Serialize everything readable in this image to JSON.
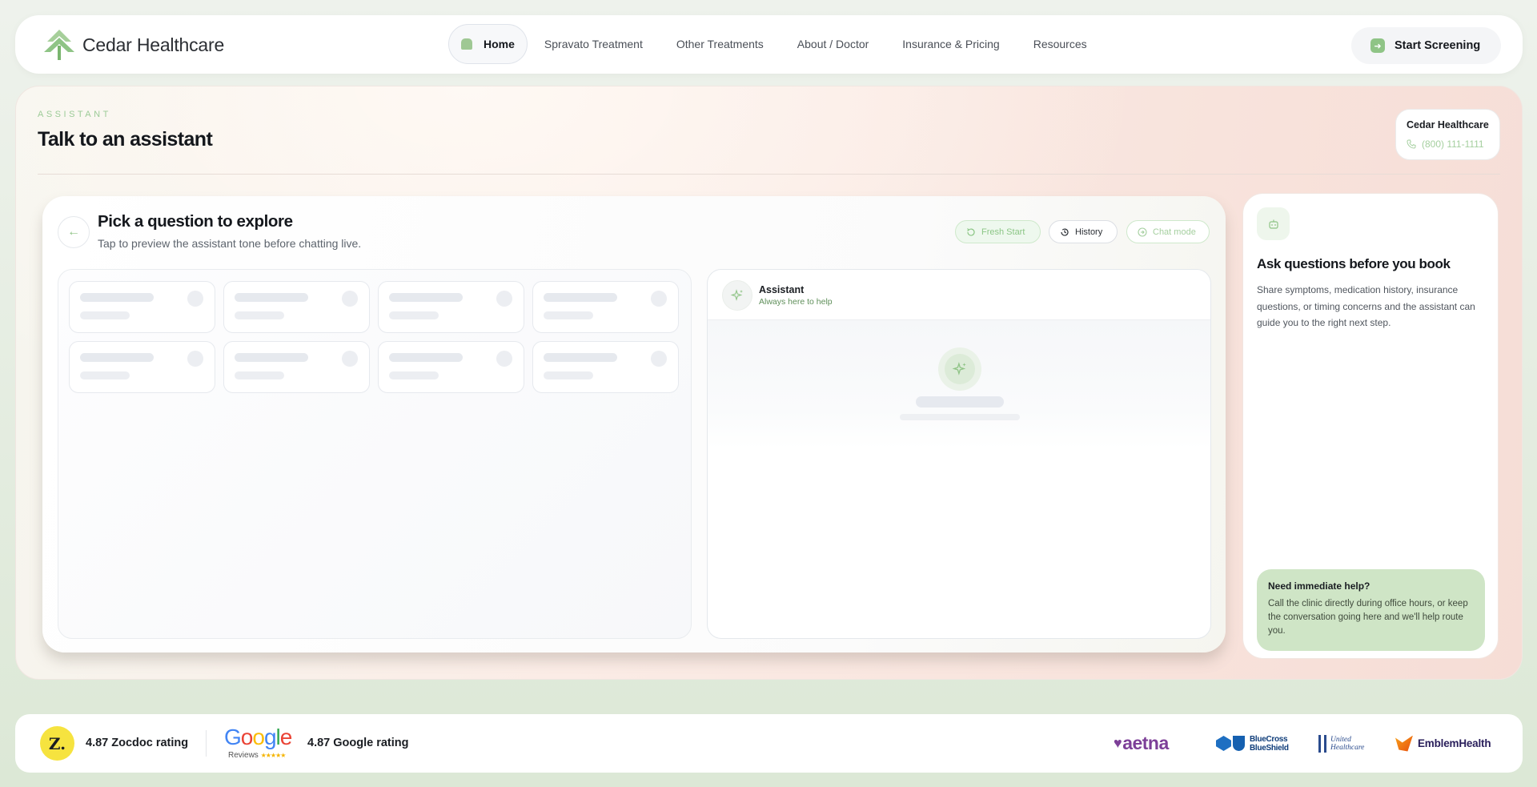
{
  "brand": {
    "name": "Cedar Healthcare"
  },
  "nav": {
    "items": [
      {
        "label": "Home",
        "active": true
      },
      {
        "label": "Spravato Treatment"
      },
      {
        "label": "Other Treatments"
      },
      {
        "label": "About / Doctor"
      },
      {
        "label": "Insurance & Pricing"
      },
      {
        "label": "Resources"
      }
    ],
    "cta_label": "Start Screening"
  },
  "page": {
    "eyebrow": "ASSISTANT",
    "title": "Talk to an assistant",
    "clinic": {
      "name": "Cedar Healthcare",
      "phone": "(800) 111-1111"
    }
  },
  "explorer": {
    "title": "Pick a question to explore",
    "subtitle": "Tap to preview the assistant tone before chatting live.",
    "actions": {
      "fresh_start": "Fresh Start",
      "history": "History",
      "chat_mode": "Chat mode"
    }
  },
  "chat": {
    "name": "Assistant",
    "status": "Always here to help"
  },
  "side": {
    "title": "Ask questions before you book",
    "text": "Share symptoms, medication history, insurance questions, or timing concerns and the assistant can guide you to the right next step.",
    "help_title": "Need immediate help?",
    "help_text": "Call the clinic directly during office hours, or keep the conversation going here and we'll help route you."
  },
  "footer": {
    "zocdoc_badge": "Z.",
    "zocdoc_rating": "4.87 Zocdoc rating",
    "google_word": [
      "G",
      "o",
      "o",
      "g",
      "l",
      "e"
    ],
    "google_reviews": "Reviews",
    "google_stars": "★★★★★",
    "google_rating": "4.87 Google rating",
    "insurers": {
      "aetna": "aetna",
      "bcbs_line1": "BlueCross",
      "bcbs_line2": "BlueShield",
      "uhc_line1": "United",
      "uhc_line2": "Healthcare",
      "emblem": "EmblemHealth"
    }
  },
  "colors": {
    "accent_green": "#8fc486",
    "light_green": "#cfe5c6",
    "peach": "#f8e3dc",
    "zocdoc_yellow": "#f6e33f",
    "aetna_purple": "#7d3f98"
  }
}
